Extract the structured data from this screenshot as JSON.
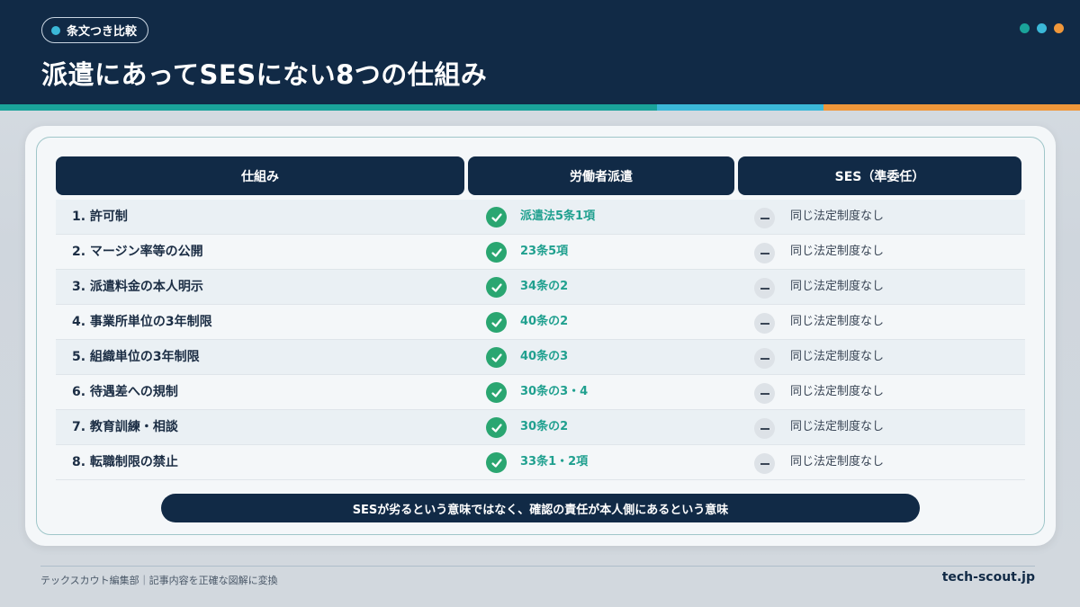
{
  "header": {
    "badge": "条文つき比較",
    "title": "派遣にあってSESにない8つの仕組み",
    "dot_colors": [
      "#1aa39a",
      "#3bb8d8",
      "#f0973a"
    ],
    "stripe_colors": [
      "#1aa39a",
      "#3bb8d8",
      "#f0973a"
    ]
  },
  "table": {
    "headers": [
      "仕組み",
      "労働者派遣",
      "SES（準委任）"
    ],
    "rows": [
      {
        "name": "1. 許可制",
        "dispatch": "派遣法5条1項",
        "ses": "同じ法定制度なし"
      },
      {
        "name": "2. マージン率等の公開",
        "dispatch": "23条5項",
        "ses": "同じ法定制度なし"
      },
      {
        "name": "3. 派遣料金の本人明示",
        "dispatch": "34条の2",
        "ses": "同じ法定制度なし"
      },
      {
        "name": "4. 事業所単位の3年制限",
        "dispatch": "40条の2",
        "ses": "同じ法定制度なし"
      },
      {
        "name": "5. 組織単位の3年制限",
        "dispatch": "40条の3",
        "ses": "同じ法定制度なし"
      },
      {
        "name": "6. 待遇差への規制",
        "dispatch": "30条の3・4",
        "ses": "同じ法定制度なし"
      },
      {
        "name": "7. 教育訓練・相談",
        "dispatch": "30条の2",
        "ses": "同じ法定制度なし"
      },
      {
        "name": "8. 転職制限の禁止",
        "dispatch": "33条1・2項",
        "ses": "同じ法定制度なし"
      }
    ],
    "check_icon": "check-circle-icon",
    "minus_icon": "minus-circle-icon",
    "check_color": "#2aa671",
    "law_color": "#20a08f"
  },
  "note": "SESが劣るという意味ではなく、確認の責任が本人側にあるという意味",
  "footer": {
    "left": "テックスカウト編集部｜記事内容を正確な図解に変換",
    "right": "tech-scout.jp"
  }
}
